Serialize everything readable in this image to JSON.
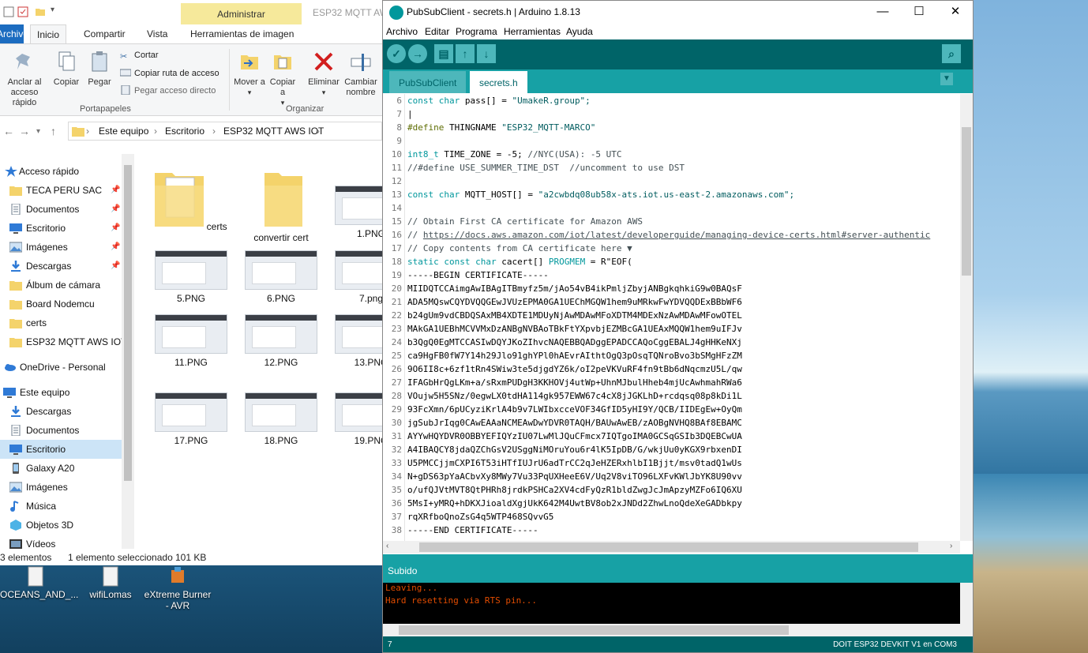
{
  "explorer": {
    "contextual_tab": "Administrar",
    "title": "ESP32 MQTT AWS IOT",
    "tabs": [
      "Archivo",
      "Inicio",
      "Compartir",
      "Vista",
      "Herramientas de imagen"
    ],
    "ribbon": {
      "pin_label": "Anclar al acceso rápido",
      "copy": "Copiar",
      "paste": "Pegar",
      "cut": "Cortar",
      "copy_path": "Copiar ruta de acceso",
      "paste_shortcut": "Pegar acceso directo",
      "group_clipboard": "Portapapeles",
      "move_to": "Mover a",
      "copy_to": "Copiar a",
      "delete": "Eliminar",
      "rename": "Cambiar nombre",
      "group_organize": "Organizar"
    },
    "breadcrumbs": [
      "Este equipo",
      "Escritorio",
      "ESP32 MQTT AWS IOT"
    ],
    "nav_items": [
      {
        "label": "Acceso rápido",
        "icon": "star-icon"
      },
      {
        "label": "TECA PERU SAC",
        "icon": "folder-icon"
      },
      {
        "label": "Documentos",
        "icon": "documents-icon"
      },
      {
        "label": "Escritorio",
        "icon": "desktop-icon"
      },
      {
        "label": "Imágenes",
        "icon": "pictures-icon"
      },
      {
        "label": "Descargas",
        "icon": "download-icon"
      },
      {
        "label": "Álbum de cámara",
        "icon": "folder-icon"
      },
      {
        "label": "Board Nodemcu",
        "icon": "folder-icon"
      },
      {
        "label": "certs",
        "icon": "folder-icon"
      },
      {
        "label": "ESP32 MQTT AWS IOT",
        "icon": "folder-icon"
      },
      {
        "label": "OneDrive - Personal",
        "icon": "cloud-icon"
      },
      {
        "label": "Este equipo",
        "icon": "computer-icon"
      },
      {
        "label": "Descargas",
        "icon": "download-icon"
      },
      {
        "label": "Documentos",
        "icon": "documents-icon"
      },
      {
        "label": "Escritorio",
        "icon": "desktop-icon"
      },
      {
        "label": "Galaxy A20",
        "icon": "phone-icon"
      },
      {
        "label": "Imágenes",
        "icon": "pictures-icon"
      },
      {
        "label": "Música",
        "icon": "music-icon"
      },
      {
        "label": "Objetos 3D",
        "icon": "cube-icon"
      },
      {
        "label": "Vídeos",
        "icon": "video-icon"
      }
    ],
    "files": [
      "certs",
      "convertir cert",
      "1.PNG",
      "5.PNG",
      "6.PNG",
      "7.png",
      "11.PNG",
      "12.PNG",
      "13.PNG",
      "17.PNG",
      "18.PNG",
      "19.PNG"
    ],
    "status": {
      "count": "3 elementos",
      "selection": "1 elemento seleccionado",
      "size": "101 KB"
    }
  },
  "desktop_icons": [
    "OCEANS_AND_...",
    "wifiLomas",
    "eXtreme Burner - AVR"
  ],
  "arduino": {
    "title": "PubSubClient - secrets.h | Arduino 1.8.13",
    "menu": [
      "Archivo",
      "Editar",
      "Programa",
      "Herramientas",
      "Ayuda"
    ],
    "tabs": [
      "PubSubClient",
      "secrets.h"
    ],
    "line_numbers": [
      "6",
      "7",
      "8",
      "9",
      "10",
      "11",
      "12",
      "13",
      "14",
      "15",
      "16",
      "17",
      "18",
      "19",
      "20",
      "21",
      "22",
      "23",
      "24",
      "25",
      "26",
      "27",
      "28",
      "29",
      "30",
      "31",
      "32",
      "33",
      "34",
      "35",
      "36",
      "37",
      "38"
    ],
    "code": {
      "l6_kw": "const char",
      "l6_rest": " pass[] = ",
      "l6_str": "\"UmakeR.group\";",
      "l8_dir": "#define",
      "l8_rest": " THINGNAME ",
      "l8_str": "\"ESP32_MQTT-MARCO\"",
      "l10_kw": "int8_t",
      "l10_rest": " TIME_ZONE = -5; ",
      "l10_cm": "//NYC(USA): -5 UTC",
      "l11_cm": "//#define USE_SUMMER_TIME_DST  //uncomment to use DST",
      "l13_kw": "const char",
      "l13_rest": " MQTT_HOST[] = ",
      "l13_str": "\"a2cwbdq08ub58x-ats.iot.us-east-2.amazonaws.com\";",
      "l15_cm": "// Obtain First CA certificate for Amazon AWS",
      "l16_cm": "// ",
      "l16_link": "https://docs.aws.amazon.com/iot/latest/developerguide/managing-device-certs.html#server-authentic",
      "l17_cm": "// Copy contents from CA certificate here ▼",
      "l18_kw": "static const char",
      "l18_rest": " cacert[] ",
      "l18_kw2": "PROGMEM",
      "l18_rest2": " = R\"EOF(",
      "cert": [
        "-----BEGIN CERTIFICATE-----",
        "MIIDQTCCAimgAwIBAgITBmyfz5m/jAo54vB4ikPmljZbyjANBgkqhkiG9w0BAQsF",
        "ADA5MQswCQYDVQQGEwJVUzEPMA0GA1UEChMGQW1hem9uMRkwFwYDVQQDExBBbWF6",
        "b24gUm9vdCBDQSAxMB4XDTE1MDUyNjAwMDAwMFoXDTM4MDExNzAwMDAwMFowOTEL",
        "MAkGA1UEBhMCVVMxDzANBgNVBAoTBkFtYXpvbjEZMBcGA1UEAxMQQW1hem9uIFJv",
        "b3QgQ0EgMTCCASIwDQYJKoZIhvcNAQEBBQADggEPADCCAQoCggEBALJ4gHHKeNXj",
        "ca9HgFB0fW7Y14h29Jlo91ghYPl0hAEvrAIthtOgQ3pOsqTQNroBvo3bSMgHFzZM",
        "9O6II8c+6zf1tRn4SWiw3te5djgdYZ6k/oI2peVKVuRF4fn9tBb6dNqcmzU5L/qw",
        "IFAGbHrQgLKm+a/sRxmPUDgH3KKHOVj4utWp+UhnMJbulHheb4mjUcAwhmahRWa6",
        "VOujw5H5SNz/0egwLX0tdHA114gk957EWW67c4cX8jJGKLhD+rcdqsq08p8kDi1L",
        "93FcXmn/6pUCyziKrlA4b9v7LWIbxcceVOF34GfID5yHI9Y/QCB/IIDEgEw+OyQm",
        "jgSubJrIqg0CAwEAAaNCMEAwDwYDVR0TAQH/BAUwAwEB/zAOBgNVHQ8BAf8EBAMC",
        "AYYwHQYDVR0OBBYEFIQYzIU07LwMlJQuCFmcx7IQTgoIMA0GCSqGSIb3DQEBCwUA",
        "A4IBAQCY8jdaQZChGsV2USggNiMOruYou6r4lK5IpDB/G/wkjUu0yKGX9rbxenDI",
        "U5PMCCjjmCXPI6T53iHTfIUJrU6adTrCC2qJeHZERxhlbI1Bjjt/msv0tadQ1wUs",
        "N+gDS63pYaACbvXy8MWy7Vu33PqUXHeeE6V/Uq2V8viTO96LXFvKWlJbYK8U90vv",
        "o/ufQJVtMVT8QtPHRh8jrdkPSHCa2XV4cdFyQzR1bldZwgJcJmApzyMZFo6IQ6XU",
        "5MsI+yMRQ+hDKXJioaldXgjUkK642M4UwtBV8ob2xJNDd2ZhwLnoQdeXeGADbkpy",
        "rqXRfboQnoZsG4q5WTP468SQvvG5",
        "-----END CERTIFICATE-----"
      ]
    },
    "status": "Subido",
    "console": [
      "Leaving...",
      "Hard resetting via RTS pin..."
    ],
    "footer_line": "7",
    "footer_board": "DOIT ESP32 DEVKIT V1 en COM3"
  },
  "colors": {
    "arduino_teal": "#17a1a5",
    "arduino_dark": "#006468",
    "explorer_accent": "#1c6cc0"
  }
}
